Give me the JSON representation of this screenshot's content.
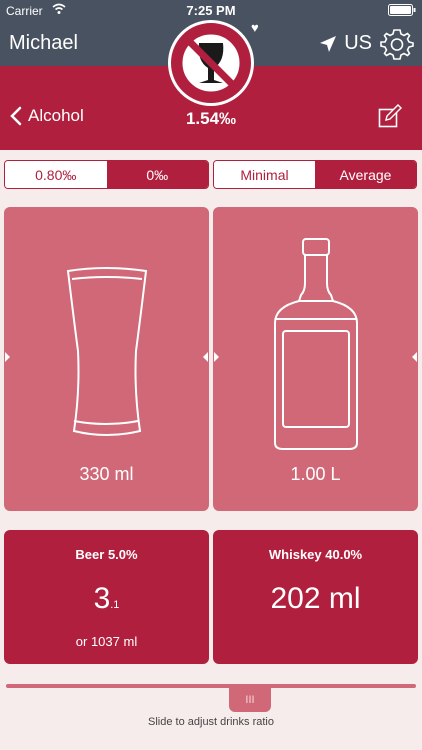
{
  "status_bar": {
    "carrier": "Carrier",
    "time": "7:25 PM"
  },
  "nav": {
    "user_name": "Michael",
    "location_label": "US"
  },
  "header": {
    "back_label": "Alcohol",
    "bac_value": "1.54‰"
  },
  "segments": {
    "limit": {
      "options": [
        "0.80‰",
        "0‰"
      ],
      "selected": "0‰"
    },
    "mode": {
      "options": [
        "Minimal",
        "Average"
      ],
      "selected": "Average"
    }
  },
  "panels": {
    "beer": {
      "volume": "330 ml",
      "icon": "beer-glass-icon"
    },
    "whiskey": {
      "volume": "1.00 L",
      "icon": "whiskey-bottle-icon"
    }
  },
  "cards": {
    "beer": {
      "title": "Beer 5.0%",
      "amount": "3",
      "amount_sub": ".1",
      "note": "or 1037 ml"
    },
    "whiskey": {
      "title": "Whiskey 40.0%",
      "amount": "202",
      "unit": "ml"
    }
  },
  "slider": {
    "handle_label": "III",
    "hint": "Slide to adjust drinks ratio"
  },
  "colors": {
    "nav": "#495260",
    "accent": "#b0203e",
    "panel": "#d06878",
    "background": "#f7ecec"
  }
}
